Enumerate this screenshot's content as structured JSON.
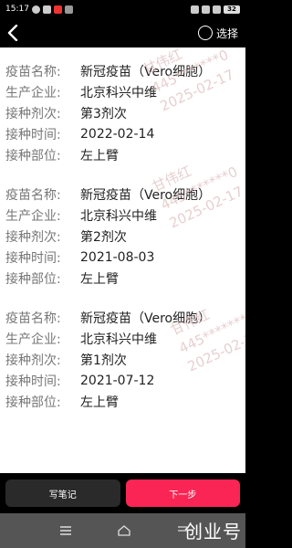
{
  "status_bar": {
    "time": "15:17",
    "battery": "32"
  },
  "top_bar": {
    "select_label": "选择"
  },
  "labels": {
    "vaccine_name": "疫苗名称:",
    "manufacturer": "生产企业:",
    "dose": "接种剂次:",
    "date": "接种时间:",
    "site": "接种部位:"
  },
  "records": [
    {
      "vaccine_name": "新冠疫苗（Vero细胞）",
      "manufacturer": "北京科兴中维",
      "dose": "第3剂次",
      "date": "2022-02-14",
      "site": "左上臂"
    },
    {
      "vaccine_name": "新冠疫苗（Vero细胞）",
      "manufacturer": "北京科兴中维",
      "dose": "第2剂次",
      "date": "2021-08-03",
      "site": "左上臂"
    },
    {
      "vaccine_name": "新冠疫苗（Vero细胞）",
      "manufacturer": "北京科兴中维",
      "dose": "第1剂次",
      "date": "2021-07-12",
      "site": "左上臂"
    }
  ],
  "watermark": {
    "name": "甘伟红",
    "id_prefix": "445*******0",
    "date": "2025-02-17"
  },
  "actions": {
    "note_label": "写笔记",
    "next_label": "下一步"
  },
  "brand": "创业号",
  "colors": {
    "accent": "#fa2555",
    "label_gray": "#777777",
    "watermark": "#e3c8c8"
  },
  "icons": {
    "back": "chevron-left-icon",
    "select": "circle-icon",
    "nav_menu": "menu-icon",
    "nav_home": "home-icon",
    "nav_back": "back-icon"
  }
}
